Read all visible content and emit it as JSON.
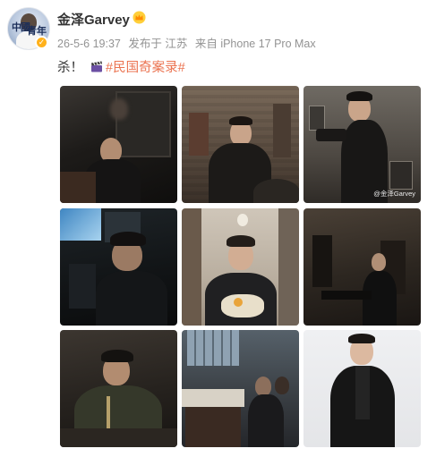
{
  "user": {
    "name": "金泽Garvey",
    "avatar_stamp_left": "中國",
    "avatar_stamp_right": "青年",
    "verified_icon": "verified-badge-icon",
    "member_icon": "crown-icon"
  },
  "meta": {
    "date": "26-5-6 19:37",
    "location": "发布于 江苏",
    "source": "来自 iPhone 17 Pro Max"
  },
  "post": {
    "text": "杀！",
    "emoji_icon": "clapper-board-icon",
    "hashtag": "#民国奇案录#"
  },
  "photos": [
    {
      "id": 1,
      "alt": "photo-1"
    },
    {
      "id": 2,
      "alt": "photo-2"
    },
    {
      "id": 3,
      "alt": "photo-3",
      "watermark": "@金泽Garvey"
    },
    {
      "id": 4,
      "alt": "photo-4"
    },
    {
      "id": 5,
      "alt": "photo-5"
    },
    {
      "id": 6,
      "alt": "photo-6"
    },
    {
      "id": 7,
      "alt": "photo-7"
    },
    {
      "id": 8,
      "alt": "photo-8"
    },
    {
      "id": 9,
      "alt": "photo-9"
    }
  ],
  "colors": {
    "hashtag": "#eb7350",
    "meta": "#939393",
    "verified": "#ffb11b"
  }
}
